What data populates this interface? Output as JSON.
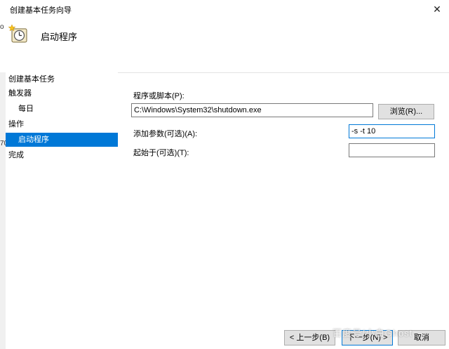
{
  "window": {
    "title": "创建基本任务向导",
    "close_glyph": "✕"
  },
  "header": {
    "title": "启动程序",
    "icon": "clock-star-icon"
  },
  "left_edge_fragments": [
    "o",
    "70"
  ],
  "nav": {
    "heading": "创建基本任务",
    "items": [
      {
        "label": "触发器",
        "level": "root",
        "selected": false
      },
      {
        "label": "每日",
        "level": "sub",
        "selected": false
      },
      {
        "label": "操作",
        "level": "root",
        "selected": false
      },
      {
        "label": "启动程序",
        "level": "sub",
        "selected": true
      },
      {
        "label": "完成",
        "level": "root",
        "selected": false
      }
    ]
  },
  "form": {
    "program_label": "程序或脚本(P):",
    "program_value": "C:\\Windows\\System32\\shutdown.exe",
    "browse_label": "浏览(R)...",
    "args_label": "添加参数(可选)(A):",
    "args_value": "-s -t 10",
    "start_in_label": "起始于(可选)(T):",
    "start_in_value": ""
  },
  "footer": {
    "back_label": "< 上一步(B)",
    "next_label": "下一步(N) >",
    "cancel_label": "取消",
    "watermark": "百度号/小白Ghost"
  },
  "colors": {
    "selection": "#0078d7",
    "focus_border": "#0078d7"
  }
}
